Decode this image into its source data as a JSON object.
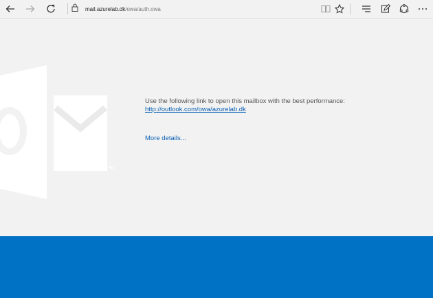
{
  "browser": {
    "url_domain": "mail.azurelab.dk",
    "url_path": "/owa/auth.owa",
    "icons": [
      "back-icon",
      "forward-icon",
      "refresh-icon",
      "lock-icon",
      "reading-view-icon",
      "favorite-star-icon",
      "hub-icon",
      "web-note-icon",
      "share-icon",
      "more-icon"
    ]
  },
  "page": {
    "message": "Use the following link to open this mailbox with the best performance:",
    "link": "http://outlook.com/owa/azurelab.dk",
    "details_link": "More details...",
    "colors": {
      "footer": "#0072c6",
      "link": "#0a5fb4",
      "background": "#f2f2f2"
    }
  }
}
